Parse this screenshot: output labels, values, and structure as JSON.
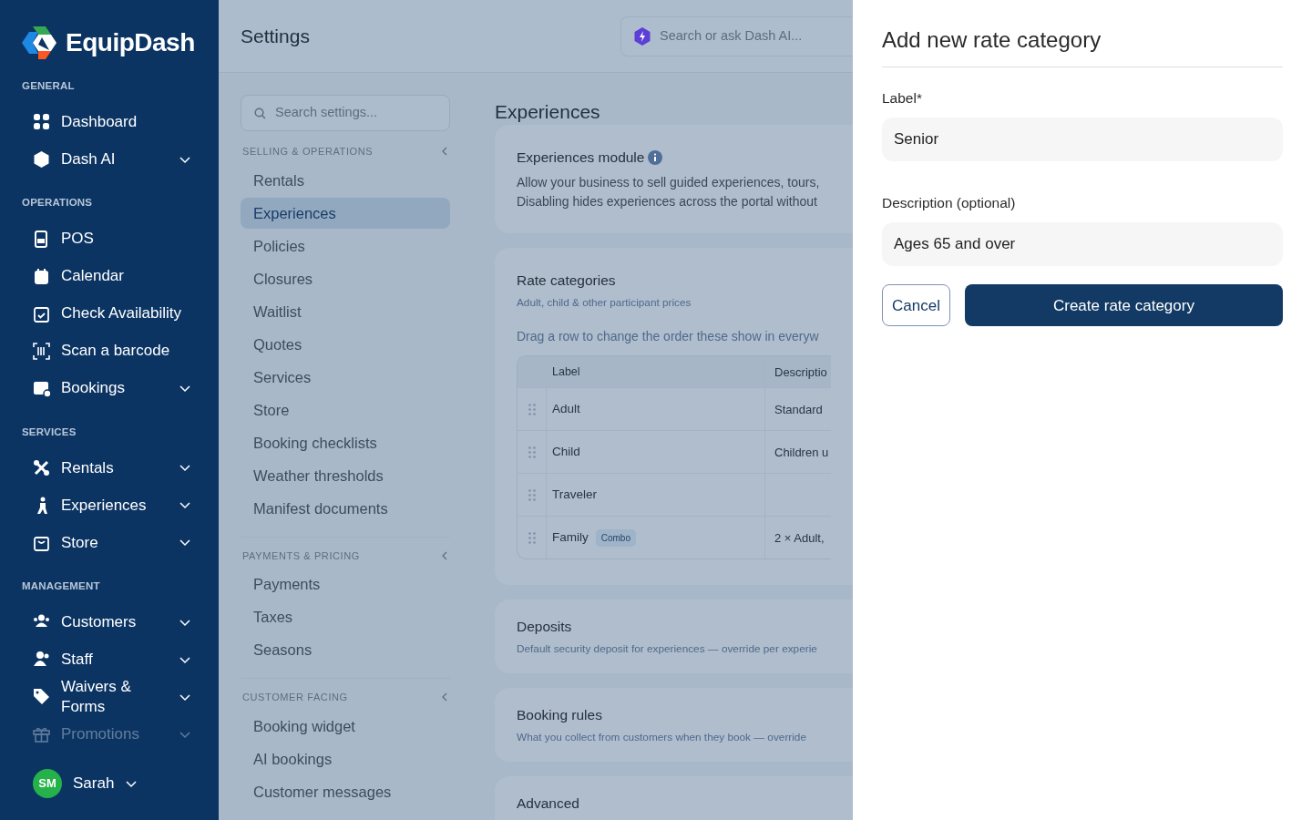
{
  "brand": {
    "name": "EquipDash"
  },
  "sidebar": {
    "sections": [
      {
        "title": "GENERAL",
        "items": [
          {
            "label": "Dashboard",
            "expandable": false
          },
          {
            "label": "Dash AI",
            "expandable": true
          }
        ]
      },
      {
        "title": "OPERATIONS",
        "items": [
          {
            "label": "POS",
            "expandable": false
          },
          {
            "label": "Calendar",
            "expandable": false
          },
          {
            "label": "Check Availability",
            "expandable": false
          },
          {
            "label": "Scan a barcode",
            "expandable": false
          },
          {
            "label": "Bookings",
            "expandable": true
          }
        ]
      },
      {
        "title": "SERVICES",
        "items": [
          {
            "label": "Rentals",
            "expandable": true
          },
          {
            "label": "Experiences",
            "expandable": true
          },
          {
            "label": "Store",
            "expandable": true
          }
        ]
      },
      {
        "title": "MANAGEMENT",
        "items": [
          {
            "label": "Customers",
            "expandable": true
          },
          {
            "label": "Staff",
            "expandable": true
          },
          {
            "label": "Waivers & Forms",
            "expandable": true
          },
          {
            "label": "Promotions",
            "expandable": true,
            "faded": true
          }
        ]
      }
    ],
    "user": {
      "initials": "SM",
      "name": "Sarah"
    }
  },
  "header": {
    "title": "Settings",
    "search": {
      "placeholder": "Search or ask Dash AI..."
    }
  },
  "settings_nav": {
    "search": {
      "placeholder": "Search settings..."
    },
    "groups": [
      {
        "title": "SELLING & OPERATIONS",
        "items": [
          {
            "label": "Rentals",
            "selected": false
          },
          {
            "label": "Experiences",
            "selected": true
          },
          {
            "label": "Policies",
            "selected": false
          },
          {
            "label": "Closures",
            "selected": false
          },
          {
            "label": "Waitlist",
            "selected": false
          },
          {
            "label": "Quotes",
            "selected": false
          },
          {
            "label": "Services",
            "selected": false
          },
          {
            "label": "Store",
            "selected": false
          },
          {
            "label": "Booking checklists",
            "selected": false
          },
          {
            "label": "Weather thresholds",
            "selected": false
          },
          {
            "label": "Manifest documents",
            "selected": false
          }
        ]
      },
      {
        "title": "PAYMENTS & PRICING",
        "items": [
          {
            "label": "Payments",
            "selected": false
          },
          {
            "label": "Taxes",
            "selected": false
          },
          {
            "label": "Seasons",
            "selected": false
          }
        ]
      },
      {
        "title": "CUSTOMER FACING",
        "items": [
          {
            "label": "Booking widget",
            "selected": false
          },
          {
            "label": "AI bookings",
            "selected": false
          },
          {
            "label": "Customer messages",
            "selected": false
          }
        ]
      }
    ]
  },
  "page": {
    "title": "Experiences",
    "cards": [
      {
        "kind": "module",
        "title": "Experiences module",
        "lines": [
          "Allow your business to sell guided experiences, tours,",
          "Disabling hides experiences across the portal without"
        ]
      },
      {
        "kind": "table",
        "title": "Rate categories",
        "subtitle": "Adult, child & other participant prices",
        "hint": "Drag a row to change the order these show in everyw",
        "columns": [
          "Label",
          "Descriptio"
        ],
        "rows": [
          {
            "label": "Adult",
            "description": "Standard"
          },
          {
            "label": "Child",
            "description": "Children u"
          },
          {
            "label": "Traveler"
          },
          {
            "label": "Family",
            "badge": "Combo",
            "description": "2 × Adult,"
          }
        ]
      },
      {
        "kind": "section",
        "title": "Deposits",
        "subtitle": "Default security deposit for experiences — override per experie"
      },
      {
        "kind": "section",
        "title": "Booking rules",
        "subtitle": "What you collect from customers when they book — override"
      },
      {
        "kind": "section",
        "title": "Advanced"
      }
    ]
  },
  "drawer": {
    "title": "Add new rate category",
    "fields": [
      {
        "label": "Label*",
        "value": "Senior"
      },
      {
        "label": "Description (optional)",
        "value": "Ages 65 and over"
      }
    ],
    "cancel": "Cancel",
    "submit": "Create rate category"
  }
}
